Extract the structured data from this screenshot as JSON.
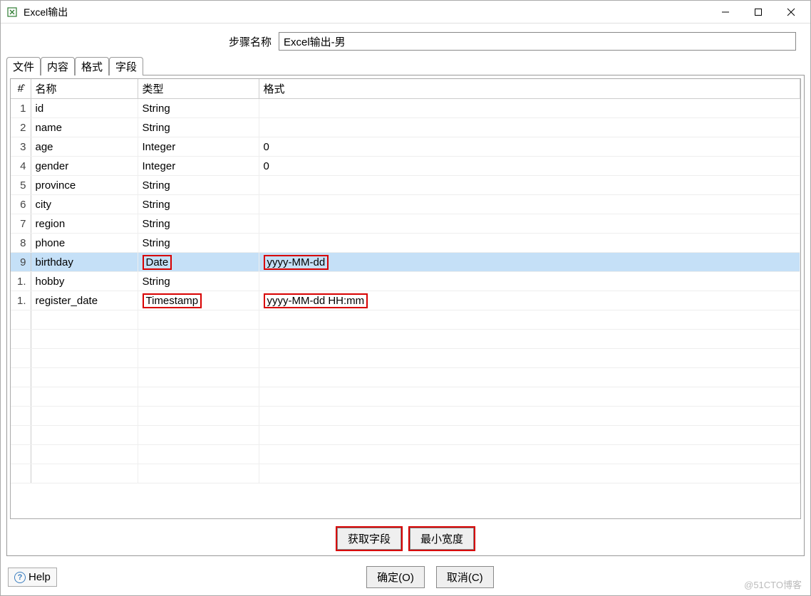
{
  "window": {
    "title": "Excel输出"
  },
  "step": {
    "label": "步骤名称",
    "value": "Excel输出-男"
  },
  "tabs": [
    "文件",
    "内容",
    "格式",
    "字段"
  ],
  "active_tab": 3,
  "columns": {
    "rownum": "#̂",
    "name": "名称",
    "type": "类型",
    "format": "格式"
  },
  "rows": [
    {
      "num": "1",
      "name": "id",
      "type": "String",
      "format": ""
    },
    {
      "num": "2",
      "name": "name",
      "type": "String",
      "format": ""
    },
    {
      "num": "3",
      "name": "age",
      "type": "Integer",
      "format": "0"
    },
    {
      "num": "4",
      "name": "gender",
      "type": "Integer",
      "format": "0"
    },
    {
      "num": "5",
      "name": "province",
      "type": "String",
      "format": ""
    },
    {
      "num": "6",
      "name": "city",
      "type": "String",
      "format": ""
    },
    {
      "num": "7",
      "name": "region",
      "type": "String",
      "format": ""
    },
    {
      "num": "8",
      "name": "phone",
      "type": "String",
      "format": ""
    },
    {
      "num": "9",
      "name": "birthday",
      "type": "Date",
      "format": "yyyy-MM-dd",
      "selected": true,
      "hl_type": true,
      "hl_format": true
    },
    {
      "num": "1.",
      "name": "hobby",
      "type": "String",
      "format": ""
    },
    {
      "num": "1.",
      "name": "register_date",
      "type": "Timestamp",
      "format": "yyyy-MM-dd HH:mm",
      "hl_type": true,
      "hl_format": true
    }
  ],
  "empty_rows": 9,
  "buttons": {
    "get_fields": "获取字段",
    "min_width": "最小宽度",
    "ok": "确定(O)",
    "cancel": "取消(C)",
    "help": "Help"
  },
  "watermark": "@51CTO博客"
}
